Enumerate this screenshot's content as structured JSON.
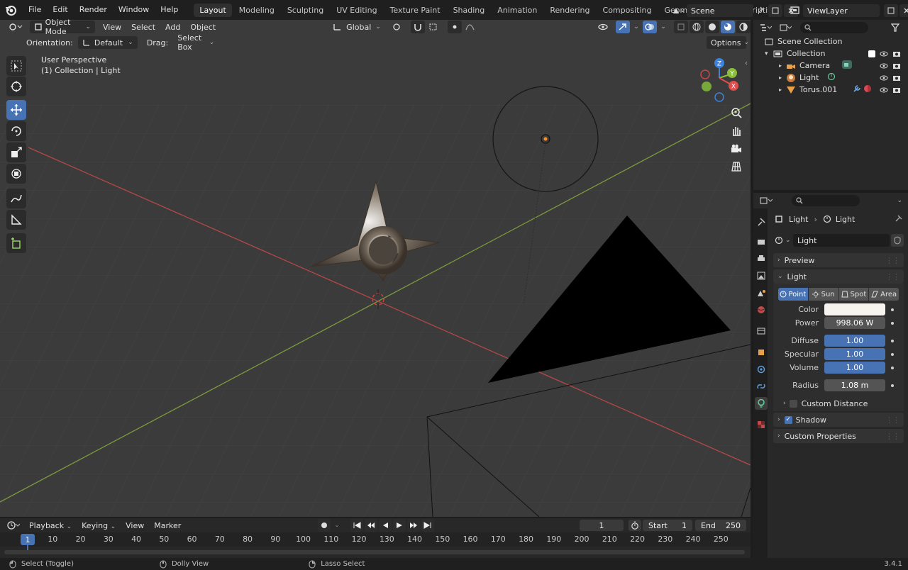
{
  "menu": [
    "File",
    "Edit",
    "Render",
    "Window",
    "Help"
  ],
  "workspaces": [
    {
      "label": "Layout",
      "active": true
    },
    {
      "label": "Modeling"
    },
    {
      "label": "Sculpting"
    },
    {
      "label": "UV Editing"
    },
    {
      "label": "Texture Paint"
    },
    {
      "label": "Shading"
    },
    {
      "label": "Animation"
    },
    {
      "label": "Rendering"
    },
    {
      "label": "Compositing"
    },
    {
      "label": "Geometry Nodes"
    },
    {
      "label": "Scripting"
    }
  ],
  "scene_name": "Scene",
  "view_layer": "ViewLayer",
  "viewport_header": {
    "mode": "Object Mode",
    "menus": [
      "View",
      "Select",
      "Add",
      "Object"
    ],
    "transform_orientation": "Global"
  },
  "tool_header": {
    "orientation_label": "Orientation:",
    "orientation_value": "Default",
    "drag_label": "Drag:",
    "drag_value": "Select Box",
    "options_label": "Options"
  },
  "viewport_info": {
    "view_name": "User Perspective",
    "context": "(1) Collection | Light"
  },
  "gizmo_axes": {
    "z": "Z",
    "y": "Y",
    "x": "X"
  },
  "outliner": {
    "root": "Scene Collection",
    "collection": "Collection",
    "items": [
      "Camera",
      "Light",
      "Torus.001"
    ]
  },
  "properties": {
    "breadcrumb_object": "Light",
    "breadcrumb_data": "Light",
    "datablock_name": "Light",
    "panels": {
      "preview": "Preview",
      "light": "Light",
      "custom_distance": "Custom Distance",
      "shadow": "Shadow",
      "custom_properties": "Custom Properties"
    },
    "light_types": [
      {
        "label": "Point",
        "active": true
      },
      {
        "label": "Sun"
      },
      {
        "label": "Spot"
      },
      {
        "label": "Area"
      }
    ],
    "fields": {
      "color_label": "Color",
      "color_value": "#f7f3ee",
      "power_label": "Power",
      "power_value": "998.06 W",
      "diffuse_label": "Diffuse",
      "diffuse_value": "1.00",
      "specular_label": "Specular",
      "specular_value": "1.00",
      "volume_label": "Volume",
      "volume_value": "1.00",
      "radius_label": "Radius",
      "radius_value": "1.08 m"
    },
    "shadow_enabled": true,
    "custom_distance_enabled": false
  },
  "timeline": {
    "menus": [
      "Playback",
      "Keying",
      "View",
      "Marker"
    ],
    "current_frame": "1",
    "start_label": "Start",
    "start_value": "1",
    "end_label": "End",
    "end_value": "250",
    "ticks": [
      "10",
      "20",
      "30",
      "40",
      "50",
      "60",
      "70",
      "80",
      "90",
      "100",
      "110",
      "120",
      "130",
      "140",
      "150",
      "160",
      "170",
      "180",
      "190",
      "200",
      "210",
      "220",
      "230",
      "240",
      "250"
    ],
    "playhead": "1"
  },
  "status": {
    "left": "Select (Toggle)",
    "middle": "Dolly View",
    "right": "Lasso Select",
    "version": "3.4.1"
  },
  "colors": {
    "accent": "#4772b3",
    "x_axis": "#e04d4d",
    "y_axis": "#8bbf3a",
    "z_axis": "#3c82dc"
  }
}
